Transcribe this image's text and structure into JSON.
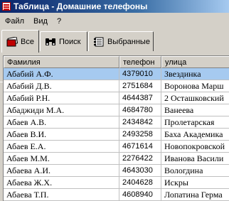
{
  "window": {
    "title": "Таблица - Домашние телефоны"
  },
  "menu": [
    "Файл",
    "Вид",
    "?"
  ],
  "tabs": [
    {
      "label": "Все",
      "icon": "cards-icon",
      "active": true
    },
    {
      "label": "Поиск",
      "icon": "binoculars-icon",
      "active": false
    },
    {
      "label": "Выбранные",
      "icon": "notebook-icon",
      "active": false
    }
  ],
  "table": {
    "headers": [
      "Фамилия",
      "телефон",
      "улица"
    ],
    "rows": [
      [
        "Абабий А.Ф.",
        "4379010",
        "Звездинка"
      ],
      [
        "Абабий Д.В.",
        "2751684",
        "Воронова Марш"
      ],
      [
        "Абабий Р.Н.",
        "4644387",
        "2 Осташковский"
      ],
      [
        "Абаджиди М.А.",
        "4684780",
        "Ванеева"
      ],
      [
        "Абаев А.В.",
        "2434842",
        "Пролетарская"
      ],
      [
        "Абаев В.И.",
        "2493258",
        "Баха Академика"
      ],
      [
        "Абаев Е.А.",
        "4671614",
        "Новопокровской"
      ],
      [
        "Абаев М.М.",
        "2276422",
        "Иванова Васили"
      ],
      [
        "Абаева А.И.",
        "4643030",
        "Вологдина"
      ],
      [
        "Абаева Ж.Х.",
        "2404628",
        "Искры"
      ],
      [
        "Абаева Т.П.",
        "4608940",
        "Лопатина Герма"
      ]
    ],
    "selected_row": 0
  },
  "colors": {
    "selection": "#a6caf0",
    "titlebar": "#0a246a"
  }
}
